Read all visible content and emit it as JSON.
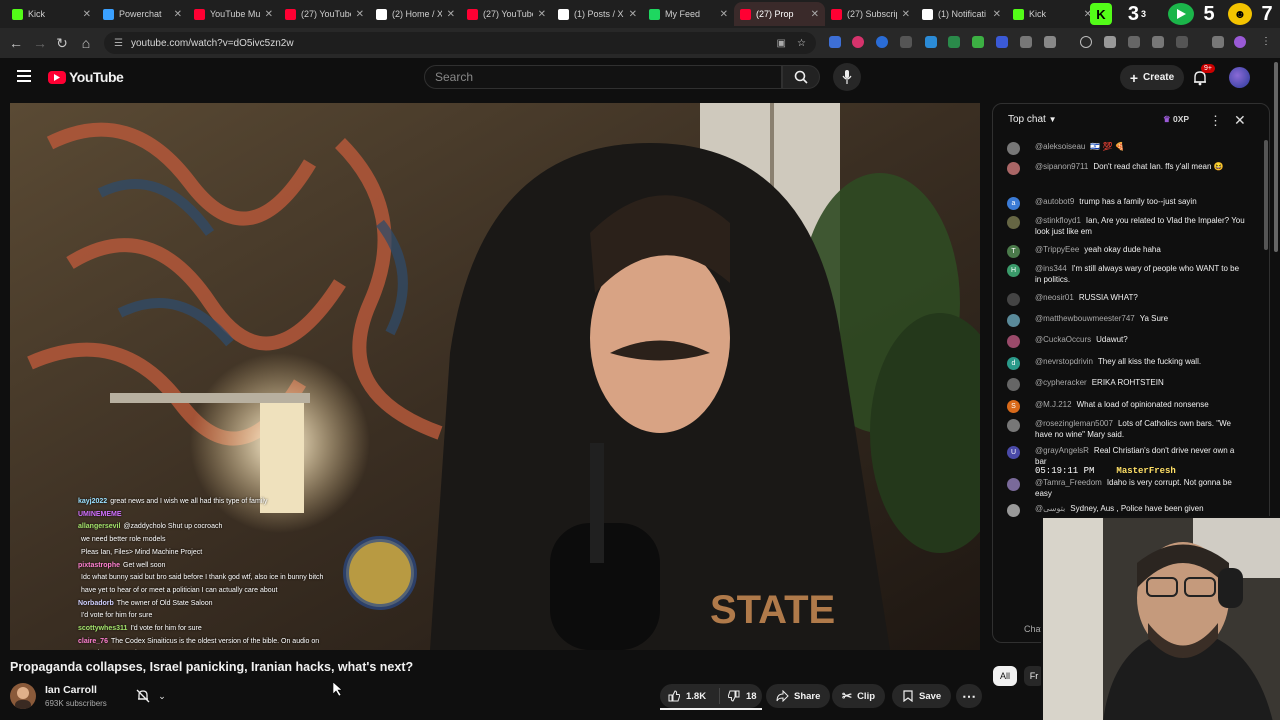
{
  "browser": {
    "tabs": [
      {
        "title": "Kick",
        "favicon_color": "#53fc18",
        "active": false
      },
      {
        "title": "Powerchat",
        "favicon_color": "#3aa0ff",
        "active": false
      },
      {
        "title": "YouTube Mu",
        "favicon_color": "#ff0033",
        "active": false
      },
      {
        "title": "(27) YouTube",
        "favicon_color": "#ff0033",
        "active": false
      },
      {
        "title": "(2) Home / X",
        "favicon_color": "#ffffff",
        "active": false
      },
      {
        "title": "(27) YouTube",
        "favicon_color": "#ff0033",
        "active": false
      },
      {
        "title": "(1) Posts / X",
        "favicon_color": "#ffffff",
        "active": false
      },
      {
        "title": "My Feed",
        "favicon_color": "#1ed760",
        "active": false
      },
      {
        "title": "(27) Prop",
        "favicon_color": "#ff0033",
        "active": true
      },
      {
        "title": "(27) Subscrip",
        "favicon_color": "#ff0033",
        "active": false
      },
      {
        "title": "(1) Notificati",
        "favicon_color": "#ffffff",
        "active": false
      },
      {
        "title": "Kick",
        "favicon_color": "#53fc18",
        "active": false
      }
    ],
    "tab_extras": [
      "3",
      "5",
      "7"
    ],
    "url": "youtube.com/watch?v=dO5ivc5zn2w"
  },
  "header": {
    "logo_text": "YouTube",
    "search_placeholder": "Search",
    "create_label": "Create",
    "notification_badge": "9+"
  },
  "video": {
    "title": "Propaganda collapses, Israel panicking, Iranian hacks, what's next?",
    "channel": "Ian Carroll",
    "subscribers": "693K subscribers",
    "likes": "1.8K",
    "dislikes": "18",
    "share_label": "Share",
    "clip_label": "Clip",
    "save_label": "Save",
    "overlay_chat": [
      {
        "user": "kayj2022",
        "text": "great news and I wish we all had this type of family",
        "color": "#9be0ff"
      },
      {
        "user": "UMINEMEME",
        "text": "",
        "color": "#d070ff"
      },
      {
        "user": "allangersevil",
        "text": "@zaddycholo Shut up cocroach",
        "color": "#a3e36b"
      },
      {
        "user": "",
        "text": "we need better role models",
        "color": "#4aa3ff"
      },
      {
        "user": "",
        "text": "Pleas Ian, Files> Mind Machine Project",
        "color": "#ff5555"
      },
      {
        "user": "pixtastrophe",
        "text": "Get well soon",
        "color": "#ff80d0"
      },
      {
        "user": "",
        "text": "Idc what bunny said but bro said before I thank god wtf, also ice in bunny bitch",
        "color": "#ff5555"
      },
      {
        "user": "",
        "text": "have yet to hear of or meet a politician I can actually care about",
        "color": "#4aa3ff"
      },
      {
        "user": "Norbadorb",
        "text": "The owner of Old State Saloon",
        "color": "#d0d0ff"
      },
      {
        "user": "",
        "text": "I'd vote for him for sure",
        "color": "#ff5555"
      },
      {
        "user": "scottywhes311",
        "text": "I'd vote for him for sure",
        "color": "#a3e36b"
      },
      {
        "user": "claire_76",
        "text": "The Codex Sinaiticus is the oldest version of the bible. On audio on YouTube. Just saying",
        "color": "#ff80d0"
      }
    ]
  },
  "chat": {
    "header_label": "Top chat",
    "xp_badge": "0XP",
    "input_placeholder": "Chat...",
    "messages": [
      {
        "author": "@aleksoiseau",
        "text": "🇮🇱 💯 🍕",
        "avatar_color": "#777",
        "initial": ""
      },
      {
        "author": "@sipanon9711",
        "text": "Don't read chat Ian. ffs y'all mean 😆",
        "avatar_color": "#a66",
        "initial": ""
      },
      {
        "author": "@autobot9",
        "text": "trump has a family too--just sayin",
        "avatar_color": "#3b7bd6",
        "initial": "a"
      },
      {
        "author": "@stinkfloyd1",
        "text": "Ian, Are you related to Vlad the Impaler? You look just like em",
        "avatar_color": "#664",
        "initial": ""
      },
      {
        "author": "@TrippyEee",
        "text": "yeah okay dude haha",
        "avatar_color": "#4a7a4a",
        "initial": "T"
      },
      {
        "author": "@ins344",
        "text": "I'm still always wary of people who WANT to be in politics.",
        "avatar_color": "#3a9a6a",
        "initial": "H"
      },
      {
        "author": "@neosir01",
        "text": "RUSSIA WHAT?",
        "avatar_color": "#444",
        "initial": ""
      },
      {
        "author": "@matthewbouwmeester747",
        "text": "Ya Sure",
        "avatar_color": "#5a8a9a",
        "initial": ""
      },
      {
        "author": "@CuckaOccurs",
        "text": "Udawut?",
        "avatar_color": "#9a4a6a",
        "initial": ""
      },
      {
        "author": "@nevrstopdrivin",
        "text": "They all kiss the fucking wall.",
        "avatar_color": "#2a9a8a",
        "initial": "d"
      },
      {
        "author": "@cypheracker",
        "text": "ERIKA ROHTSTEIN",
        "avatar_color": "#666",
        "initial": ""
      },
      {
        "author": "@M.J.212",
        "text": "What a load of opinionated nonsense",
        "avatar_color": "#d96a1a",
        "initial": "S"
      },
      {
        "author": "@rosezingleman5007",
        "text": "Lots of Catholics own bars. \"We have no wine\" Mary said.",
        "avatar_color": "#777",
        "initial": ""
      },
      {
        "author": "@grayAngelsR",
        "text": "Real Christian's don't drive never own a bar",
        "avatar_color": "#4a4aa8",
        "initial": "U"
      },
      {
        "author": "@Tamra_Freedom",
        "text": "Idaho is very corrupt. Not gonna be easy",
        "avatar_color": "#7a6a9a",
        "initial": ""
      },
      {
        "author": "@بتوسی",
        "text": "Sydney, Aus , Police have been given",
        "avatar_color": "#999",
        "initial": ""
      }
    ],
    "overlay_banner": "05:19:11 PM",
    "overlay_user": "MasterFresh"
  },
  "chips": {
    "all": "All",
    "fr": "Fr"
  }
}
